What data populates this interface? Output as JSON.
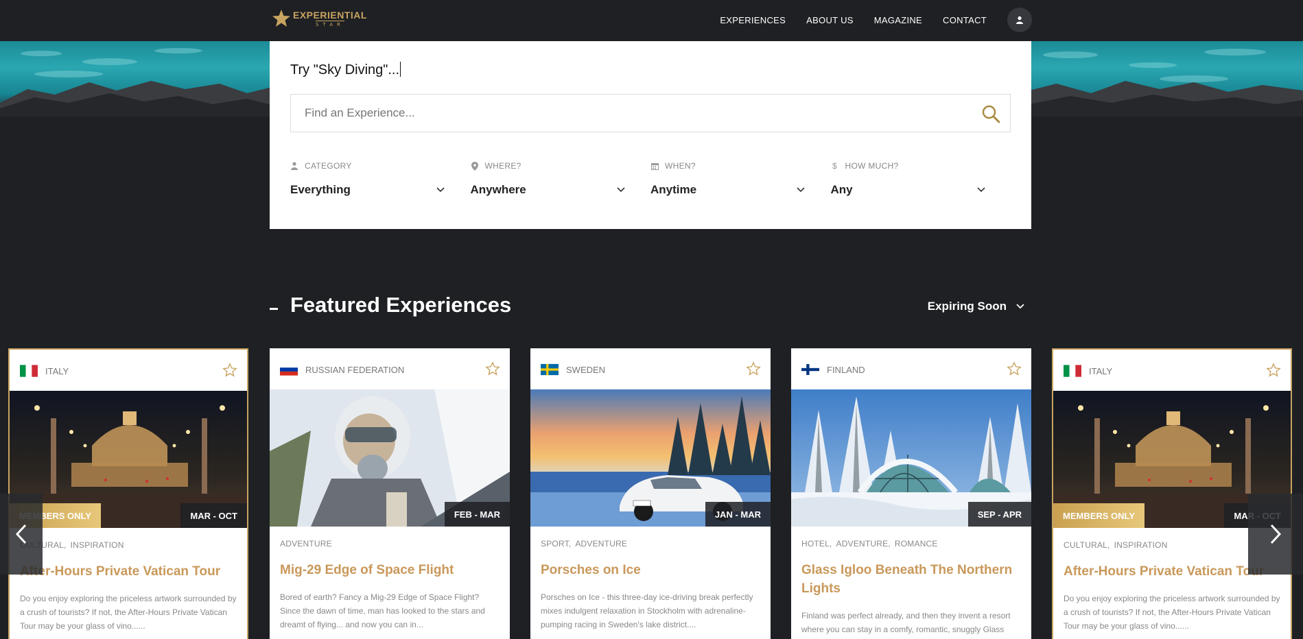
{
  "header": {
    "logo_main": "EXPERIENTIAL",
    "logo_sub": "STAR",
    "nav": [
      "EXPERIENCES",
      "ABOUT US",
      "MAGAZINE",
      "CONTACT"
    ],
    "user_icon": "user-icon"
  },
  "search": {
    "typing_text": "Try \"Sky Diving\"...",
    "placeholder": "Find an Experience...",
    "filters": [
      {
        "label": "CATEGORY",
        "icon": "person-icon",
        "value": "Everything"
      },
      {
        "label": "WHERE?",
        "icon": "location-pin-icon",
        "value": "Anywhere"
      },
      {
        "label": "WHEN?",
        "icon": "calendar-icon",
        "value": "Anytime"
      },
      {
        "label": "HOW MUCH?",
        "icon": "dollar-icon",
        "value": "Any"
      }
    ]
  },
  "featured": {
    "title": "Featured Experiences",
    "sort_label": "Expiring Soon"
  },
  "cards": [
    {
      "country": "ITALY",
      "flag": "italy",
      "badge": "MEMBERS ONLY",
      "dates": "MAR - OCT",
      "tags": [
        "CULTURAL,",
        "INSPIRATION"
      ],
      "title": "After-Hours Private Vatican Tour",
      "desc": "Do you enjoy exploring the priceless artwork surrounded by a crush of tourists? If not, the After-Hours Private Vatican Tour may be your glass of vino......"
    },
    {
      "country": "RUSSIAN FEDERATION",
      "flag": "russia",
      "badge": "",
      "dates": "FEB - MAR",
      "tags": [
        "ADVENTURE"
      ],
      "title": "Mig-29 Edge of Space Flight",
      "desc": "Bored of earth? Fancy a Mig-29 Edge of Space Flight? Since the dawn of time, man has looked to the stars and dreamt of flying... and now you can in..."
    },
    {
      "country": "SWEDEN",
      "flag": "sweden",
      "badge": "",
      "dates": "JAN - MAR",
      "tags": [
        "SPORT,",
        "ADVENTURE"
      ],
      "title": "Porsches on Ice",
      "desc": "Porsches on Ice - this three-day ice-driving break perfectly mixes indulgent relaxation in Stockholm with adrenaline-pumping racing in Sweden's lake district...."
    },
    {
      "country": "FINLAND",
      "flag": "finland",
      "badge": "",
      "dates": "SEP - APR",
      "tags": [
        "HOTEL,",
        "ADVENTURE,",
        "ROMANCE"
      ],
      "title": "Glass Igloo Beneath The Northern Lights",
      "desc": "Finland was perfect already, and then they invent a resort where you can stay in a comfy, romantic, snuggly Glass"
    },
    {
      "country": "ITALY",
      "flag": "italy",
      "badge": "MEMBERS ONLY",
      "dates": "MAR - OCT",
      "tags": [
        "CULTURAL,",
        "INSPIRATION"
      ],
      "title": "After-Hours Private Vatican Tour",
      "desc": "Do you enjoy exploring the priceless artwork surrounded by a crush of tourists? If not, the After-Hours Private Vatican Tour may be your glass of vino......"
    }
  ],
  "carousel": {
    "prev_icon": "chevron-left-icon",
    "next_icon": "chevron-right-icon"
  },
  "colors": {
    "accent": "#c9a460",
    "dark": "#1e2024",
    "title": "#c9985a"
  }
}
